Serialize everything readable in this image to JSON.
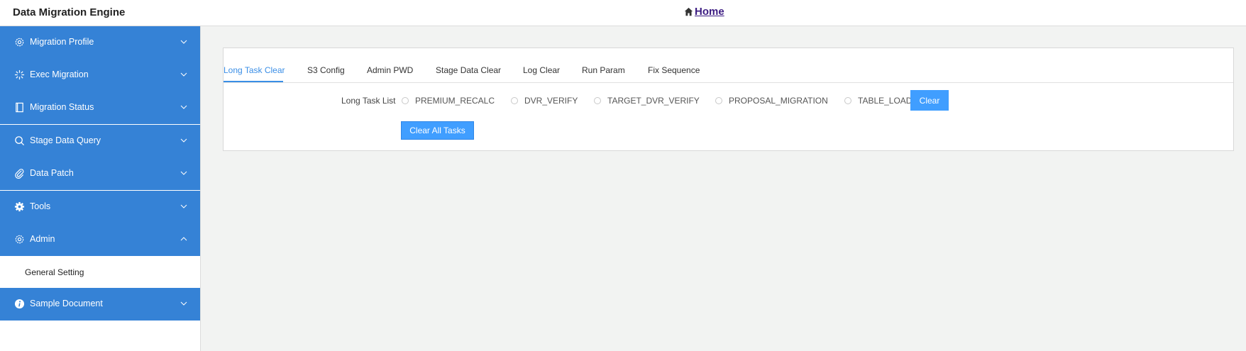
{
  "header": {
    "app_title": "Data Migration Engine",
    "home_label": "Home"
  },
  "sidebar": {
    "items": [
      {
        "label": "Migration Profile",
        "icon": "gear-icon"
      },
      {
        "label": "Exec Migration",
        "icon": "sparkle-icon"
      },
      {
        "label": "Migration Status",
        "icon": "document-icon"
      },
      {
        "label": "Stage Data Query",
        "icon": "search-icon"
      },
      {
        "label": "Data Patch",
        "icon": "paperclip-icon"
      },
      {
        "label": "Tools",
        "icon": "cog-icon"
      },
      {
        "label": "Admin",
        "icon": "gear-icon",
        "expanded": true
      },
      {
        "label": "Sample Document",
        "icon": "info-icon"
      }
    ],
    "admin_children": [
      {
        "label": "General Setting"
      }
    ]
  },
  "tabs": [
    {
      "label": "Long Task Clear",
      "active": true
    },
    {
      "label": "S3 Config"
    },
    {
      "label": "Admin PWD"
    },
    {
      "label": "Stage Data Clear"
    },
    {
      "label": "Log Clear"
    },
    {
      "label": "Run Param"
    },
    {
      "label": "Fix Sequence"
    }
  ],
  "form": {
    "long_task_label": "Long Task List",
    "options": [
      "PREMIUM_RECALC",
      "DVR_VERIFY",
      "TARGET_DVR_VERIFY",
      "PROPOSAL_MIGRATION",
      "TABLE_LOAD"
    ],
    "clear_button": "Clear",
    "clear_all_button": "Clear All Tasks"
  },
  "colors": {
    "sidebar_bg": "#3582d6",
    "accent": "#409eff",
    "active_tab": "#3a8ee6"
  }
}
